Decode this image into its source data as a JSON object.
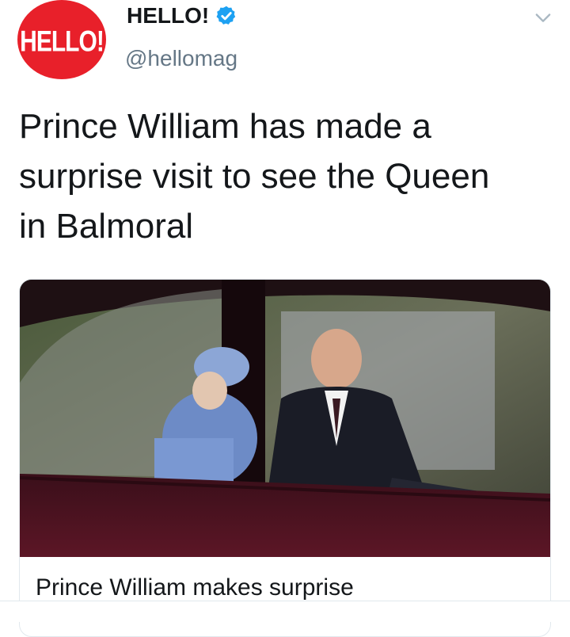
{
  "tweet": {
    "author": {
      "avatar_text": "HELLO!",
      "display_name": "HELLO!",
      "verified_icon": "verified-badge-icon",
      "handle": "@hellomag"
    },
    "text": "Prince William has made a surprise visit to see the Queen in Balmoral",
    "menu_icon": "chevron-down-icon"
  },
  "card": {
    "image_alt": "Prince William sitting in a car next to the Queen",
    "title": "Prince William makes surprise"
  },
  "colors": {
    "brand_red": "#e8202a",
    "verified_blue": "#1da1f2",
    "secondary_text": "#657786",
    "border": "#e1e8ed"
  }
}
